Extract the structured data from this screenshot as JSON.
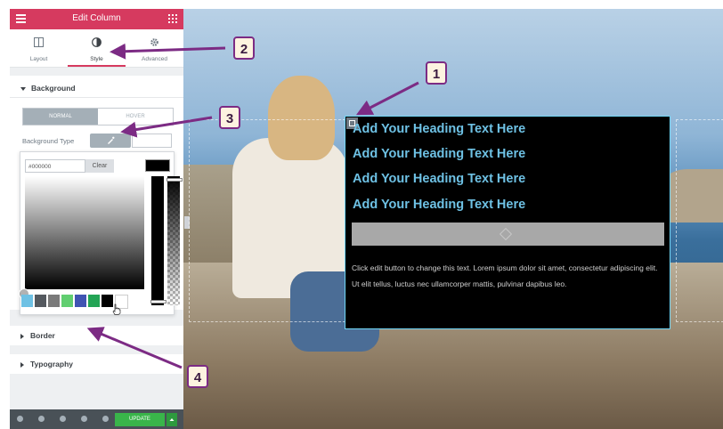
{
  "panel": {
    "title": "Edit Column",
    "tabs": [
      {
        "label": "Layout",
        "icon": "layout-icon"
      },
      {
        "label": "Style",
        "icon": "style-icon",
        "active": true
      },
      {
        "label": "Advanced",
        "icon": "gear-icon"
      }
    ],
    "background_section": "Background",
    "state_tabs": {
      "normal": "NORMAL",
      "hover": "HOVER"
    },
    "background_type_label": "Background Type",
    "color_picker": {
      "hex_value": "#000000",
      "clear_label": "Clear",
      "current_color": "#000000",
      "swatches": [
        "#6ec1e4",
        "#54595f",
        "#7a7a7a",
        "#61ce70",
        "#4054b2",
        "#23a455",
        "#000000",
        "#ffffff"
      ]
    },
    "border_section": "Border",
    "typography_section": "Typography",
    "footer": {
      "update_label": "UPDATE"
    }
  },
  "preview": {
    "headings": [
      "Add Your Heading Text Here",
      "Add Your Heading Text Here",
      "Add Your Heading Text Here",
      "Add Your Heading Text Here"
    ],
    "paragraph": "Click edit button to change this text. Lorem ipsum dolor sit amet, consectetur adipiscing elit. Ut elit tellus, luctus nec ullamcorper mattis, pulvinar dapibus leo."
  },
  "annotations": [
    "1",
    "2",
    "3",
    "4"
  ],
  "colors": {
    "brand": "#d63a5f",
    "annotation_purple": "#7c2b84",
    "heading_blue": "#6ec1e4",
    "update_green": "#39b54a"
  }
}
